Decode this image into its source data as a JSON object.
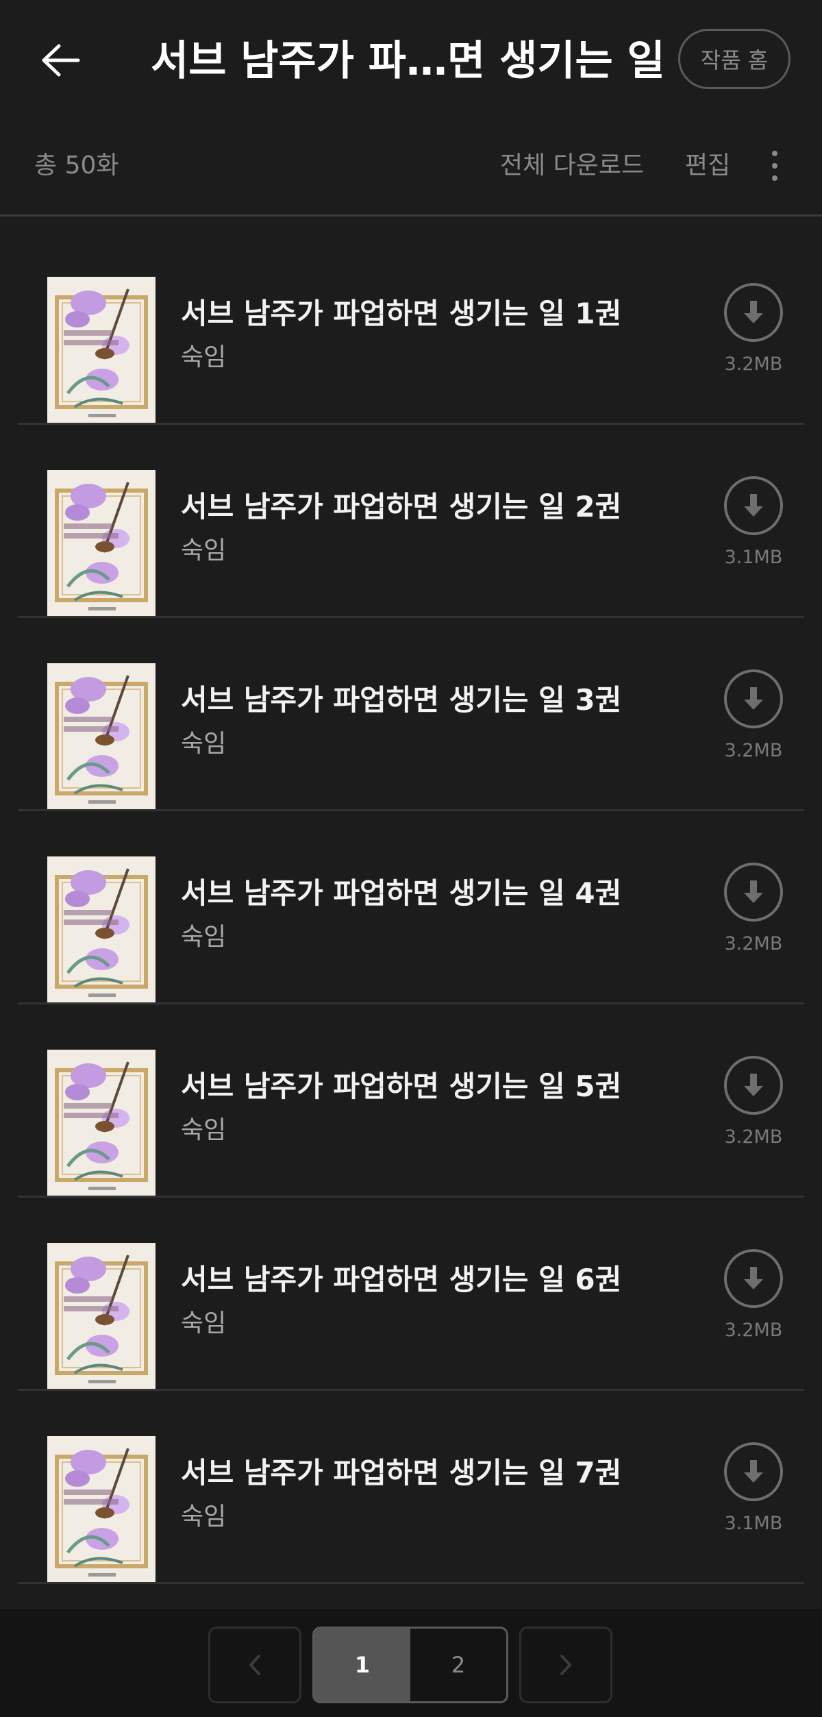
{
  "header": {
    "title": "서브 남주가 파…면 생기는 일",
    "home_label": "작품 홈"
  },
  "toolbar": {
    "total": "총 50화",
    "download_all": "전체 다운로드",
    "edit": "편집"
  },
  "colors": {
    "background": "#1c1c1c",
    "footer": "#141414",
    "active_page": "#555555"
  },
  "episodes": [
    {
      "title": "서브 남주가 파업하면 생기는 일 1권",
      "author": "숙임",
      "size": "3.2MB"
    },
    {
      "title": "서브 남주가 파업하면 생기는 일 2권",
      "author": "숙임",
      "size": "3.1MB"
    },
    {
      "title": "서브 남주가 파업하면 생기는 일 3권",
      "author": "숙임",
      "size": "3.2MB"
    },
    {
      "title": "서브 남주가 파업하면 생기는 일 4권",
      "author": "숙임",
      "size": "3.2MB"
    },
    {
      "title": "서브 남주가 파업하면 생기는 일 5권",
      "author": "숙임",
      "size": "3.2MB"
    },
    {
      "title": "서브 남주가 파업하면 생기는 일 6권",
      "author": "숙임",
      "size": "3.2MB"
    },
    {
      "title": "서브 남주가 파업하면 생기는 일 7권",
      "author": "숙임",
      "size": "3.1MB"
    }
  ],
  "pagination": {
    "pages": [
      "1",
      "2"
    ],
    "current": "1"
  }
}
